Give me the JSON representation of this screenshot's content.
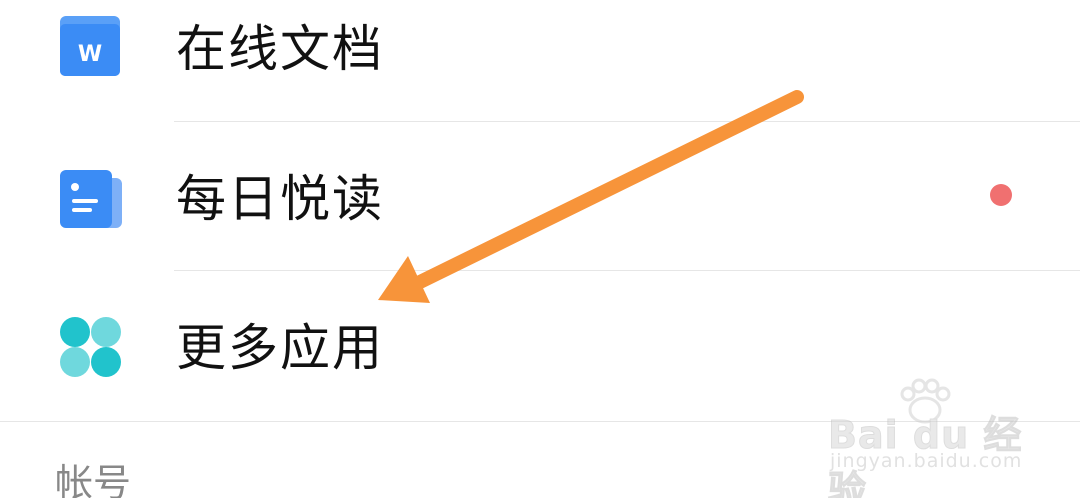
{
  "menu": {
    "items": [
      {
        "label": "在线文档",
        "icon": "online-doc-icon",
        "icon_glyph": "W"
      },
      {
        "label": "每日悦读",
        "icon": "daily-reading-icon",
        "has_badge": true
      },
      {
        "label": "更多应用",
        "icon": "more-apps-icon"
      }
    ]
  },
  "section": {
    "account_header": "帐号"
  },
  "watermark": {
    "brand": "Bai du 经验",
    "domain": "jingyan.baidu.com"
  },
  "colors": {
    "doc_blue": "#3b8cf5",
    "doc_blue_light": "#7eb0f7",
    "apps_teal": "#21c3cc",
    "apps_teal_light": "#6fd8dd",
    "badge_red": "#f07070",
    "arrow_orange": "#f7943a"
  }
}
